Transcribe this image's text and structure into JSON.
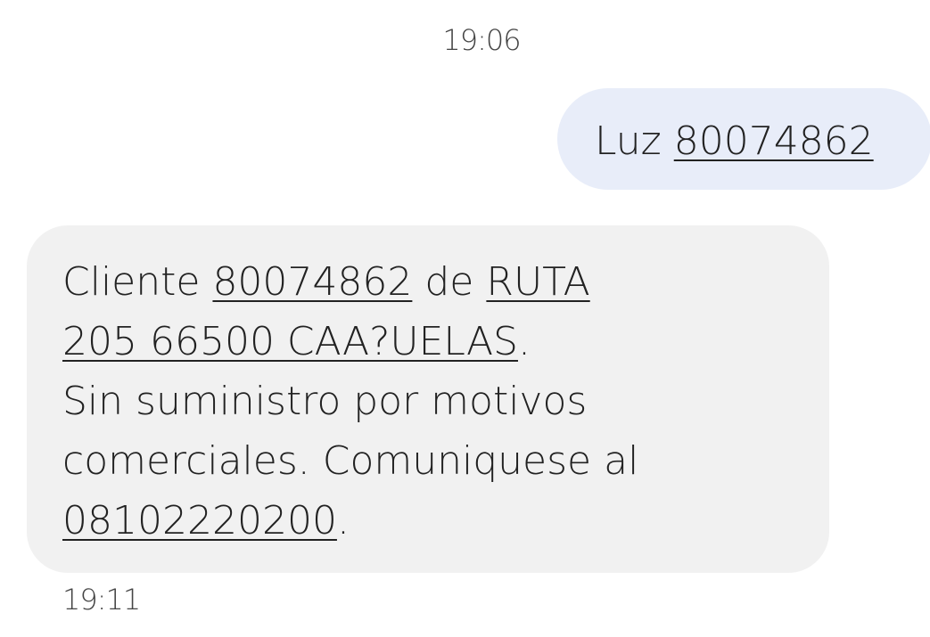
{
  "conversation": {
    "sent_timestamp": "19:06",
    "received_timestamp": "19:11"
  },
  "sent_message": {
    "prefix": "Luz ",
    "number_link": "80074862"
  },
  "received_message": {
    "line1_text_a": "Cliente ",
    "client_number_link": "80074862",
    "line1_text_b": " de ",
    "address_link_part1": "RUTA",
    "address_link_part2": "205 66500 CAA?UELAS",
    "line2_period": ".",
    "line3": "Sin suministro por motivos",
    "line4": "comerciales. Comuniquese al",
    "phone_link": "08102220200",
    "line5_period": "."
  },
  "colors": {
    "sent_bubble": "#e8edf9",
    "received_bubble": "#f1f1f1",
    "text": "#222222",
    "timestamp": "#444444"
  }
}
